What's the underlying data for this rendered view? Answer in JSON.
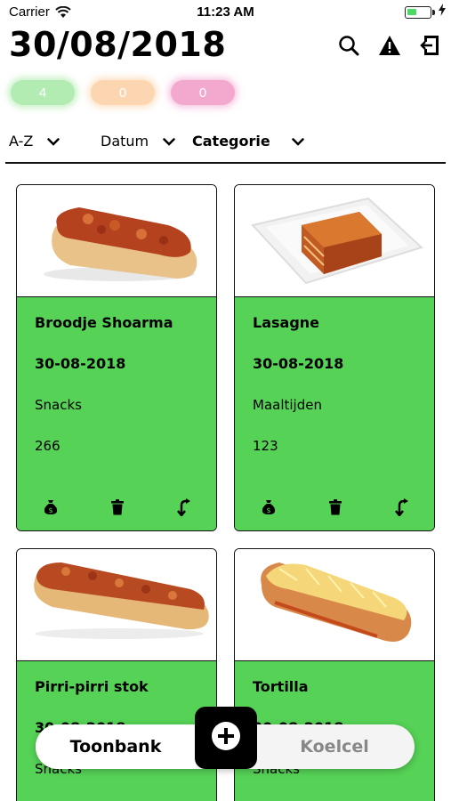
{
  "status_bar": {
    "carrier": "Carrier",
    "time": "11:23 AM",
    "battery_level": 0.4,
    "charging_icon": "bolt-icon"
  },
  "header": {
    "title": "30/08/2018",
    "icons": [
      "search-icon",
      "warning-icon",
      "logout-icon"
    ]
  },
  "counters": [
    {
      "value": "4",
      "color": "#b3ecb3"
    },
    {
      "value": "0",
      "color": "#fbd6b0"
    },
    {
      "value": "0",
      "color": "#f2a9cd"
    }
  ],
  "sort": {
    "az": "A-Z",
    "datum": "Datum",
    "categorie": "Categorie"
  },
  "products": [
    {
      "name": "Broodje Shoarma",
      "date": "30-08-2018",
      "category": "Snacks",
      "number": "266"
    },
    {
      "name": "Lasagne",
      "date": "30-08-2018",
      "category": "Maaltijden",
      "number": "123"
    },
    {
      "name": "Pirri-pirri stok",
      "date": "30-08-2018",
      "category": "Snacks",
      "number": ""
    },
    {
      "name": "Tortilla",
      "date": "30-08-2018",
      "category": "Snacks",
      "number": ""
    }
  ],
  "bottom_bar": {
    "left_label": "Toonbank",
    "right_label": "Koelcel",
    "add_icon": "plus-icon"
  },
  "colors": {
    "card_green": "#56d256",
    "accent": "#000000"
  }
}
